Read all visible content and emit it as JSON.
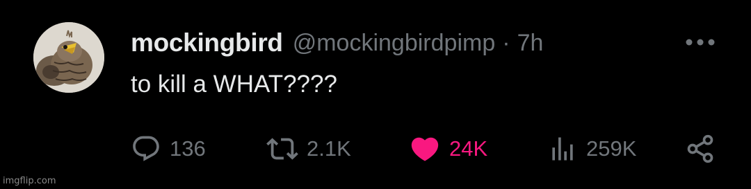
{
  "tweet": {
    "display_name": "mockingbird",
    "handle": "@mockingbirdpimp",
    "separator": "·",
    "time": "7h",
    "text": "to kill a WHAT????"
  },
  "actions": {
    "reply": {
      "icon": "reply-icon",
      "count": "136"
    },
    "retweet": {
      "icon": "retweet-icon",
      "count": "2.1K"
    },
    "like": {
      "icon": "heart-icon",
      "count": "24K",
      "liked": true,
      "color": "#f91880"
    },
    "views": {
      "icon": "views-icon",
      "count": "259K"
    },
    "share": {
      "icon": "share-icon"
    }
  },
  "colors": {
    "background": "#000000",
    "text": "#e7e9ea",
    "muted": "#71767b",
    "like": "#f91880"
  },
  "watermark": "imgflip.com"
}
